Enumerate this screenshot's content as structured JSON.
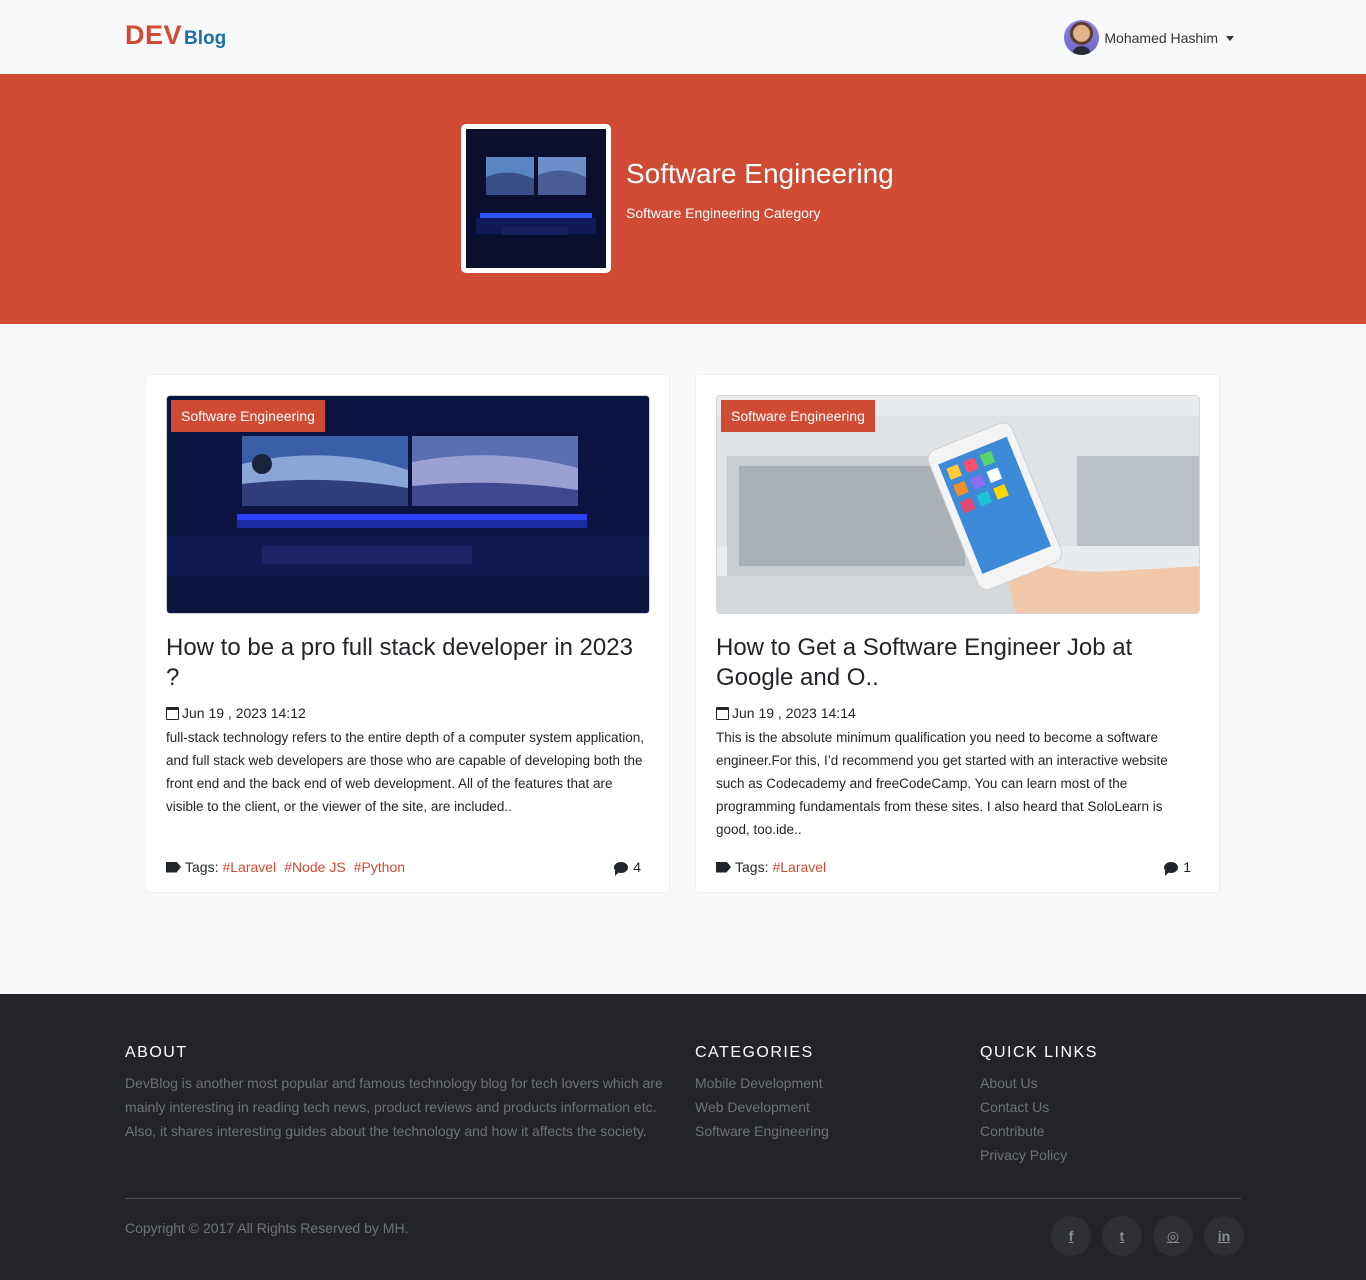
{
  "nav": {
    "brand_dev": "DEV",
    "brand_blog": "Blog",
    "user_name": "Mohamed Hashim"
  },
  "hero": {
    "title": "Software Engineering",
    "subtitle": "Software Engineering Category"
  },
  "posts": [
    {
      "category": "Software Engineering",
      "title": "How to be a pro full stack developer in 2023 ?",
      "date": "Jun 19 , 2023 14:12",
      "excerpt": "full-stack technology refers to the entire depth of a computer system application, and full stack web developers are those who are capable of developing both the front end and the back end of web development. All of the features that are visible to the client, or the viewer of the site, are included..",
      "tags_label": "Tags:",
      "tags": [
        "#Laravel",
        "#Node JS",
        "#Python"
      ],
      "comments": "4"
    },
    {
      "category": "Software Engineering",
      "title": "How to Get a Software Engineer Job at Google and O..",
      "date": "Jun 19 , 2023 14:14",
      "excerpt": "This is the absolute minimum qualification you need to become a software engineer.For this, I’d recommend you get started with an interactive website such as Codecademy and freeCodeCamp. You can learn most of the programming fundamentals from these sites. I also heard that SoloLearn is good, too.ide..",
      "tags_label": "Tags:",
      "tags": [
        "#Laravel"
      ],
      "comments": "1"
    }
  ],
  "footer": {
    "about_title": "ABOUT",
    "about_text": "DevBlog is another most popular and famous technology blog for tech lovers which are mainly interesting in reading tech news, product reviews and products information etc. Also, it shares interesting guides about the technology and how it affects the society.",
    "categories_title": "CATEGORIES",
    "categories": [
      "Mobile Development",
      "Web Development",
      "Software Engineering"
    ],
    "links_title": "QUICK LINKS",
    "links": [
      "About Us",
      "Contact Us",
      "Contribute",
      "Privacy Policy"
    ],
    "copyright": "Copyright © 2017 All Rights Reserved by MH.",
    "socials": [
      {
        "icon": "facebook-icon",
        "glyph": "f"
      },
      {
        "icon": "twitter-icon",
        "glyph": "t"
      },
      {
        "icon": "dribbble-icon",
        "glyph": "◎"
      },
      {
        "icon": "linkedin-icon",
        "glyph": "in"
      }
    ]
  },
  "colors": {
    "accent": "#d04b34",
    "brand_blue": "#1d6fa5",
    "footer_bg": "#232427"
  }
}
